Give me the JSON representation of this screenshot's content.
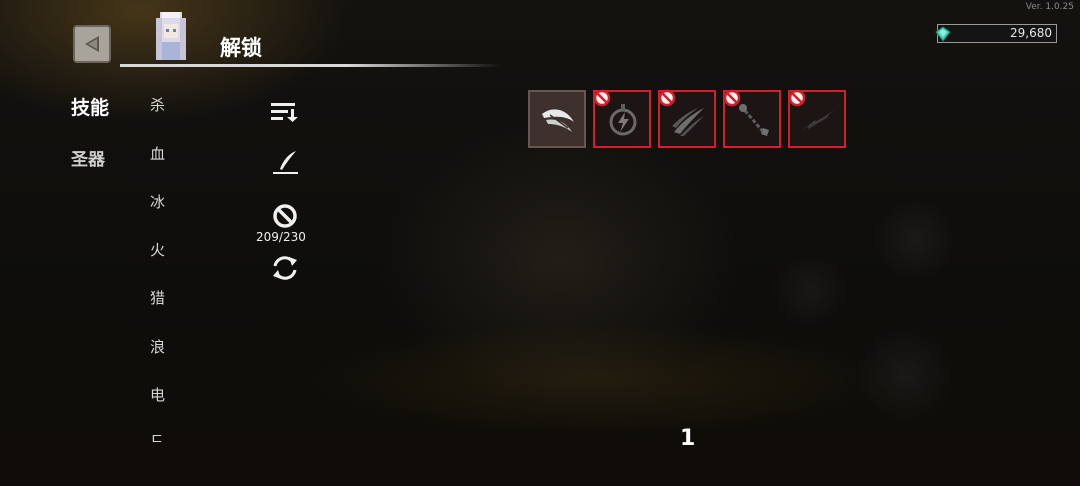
{
  "version": "Ver. 1.0.25",
  "header": {
    "title": "解锁",
    "currency_value": "29,680"
  },
  "tabs": [
    {
      "label": "技能"
    },
    {
      "label": "圣器"
    }
  ],
  "filters": [
    "杀",
    "血",
    "冰",
    "火",
    "猎",
    "浪",
    "电",
    "ㄷ"
  ],
  "toolbar": {
    "unlock_counter": "209/230"
  },
  "skills": [
    {
      "icon": "blade-wing-icon",
      "locked": false
    },
    {
      "icon": "lightning-orb-icon",
      "locked": true
    },
    {
      "icon": "claw-slash-icon",
      "locked": true
    },
    {
      "icon": "chain-mace-icon",
      "locked": true
    },
    {
      "icon": "dark-slash-icon",
      "locked": true
    }
  ],
  "pagination": {
    "page": "1"
  },
  "colors": {
    "locked_border": "#d1202a",
    "selected_border": "#6a5551"
  }
}
